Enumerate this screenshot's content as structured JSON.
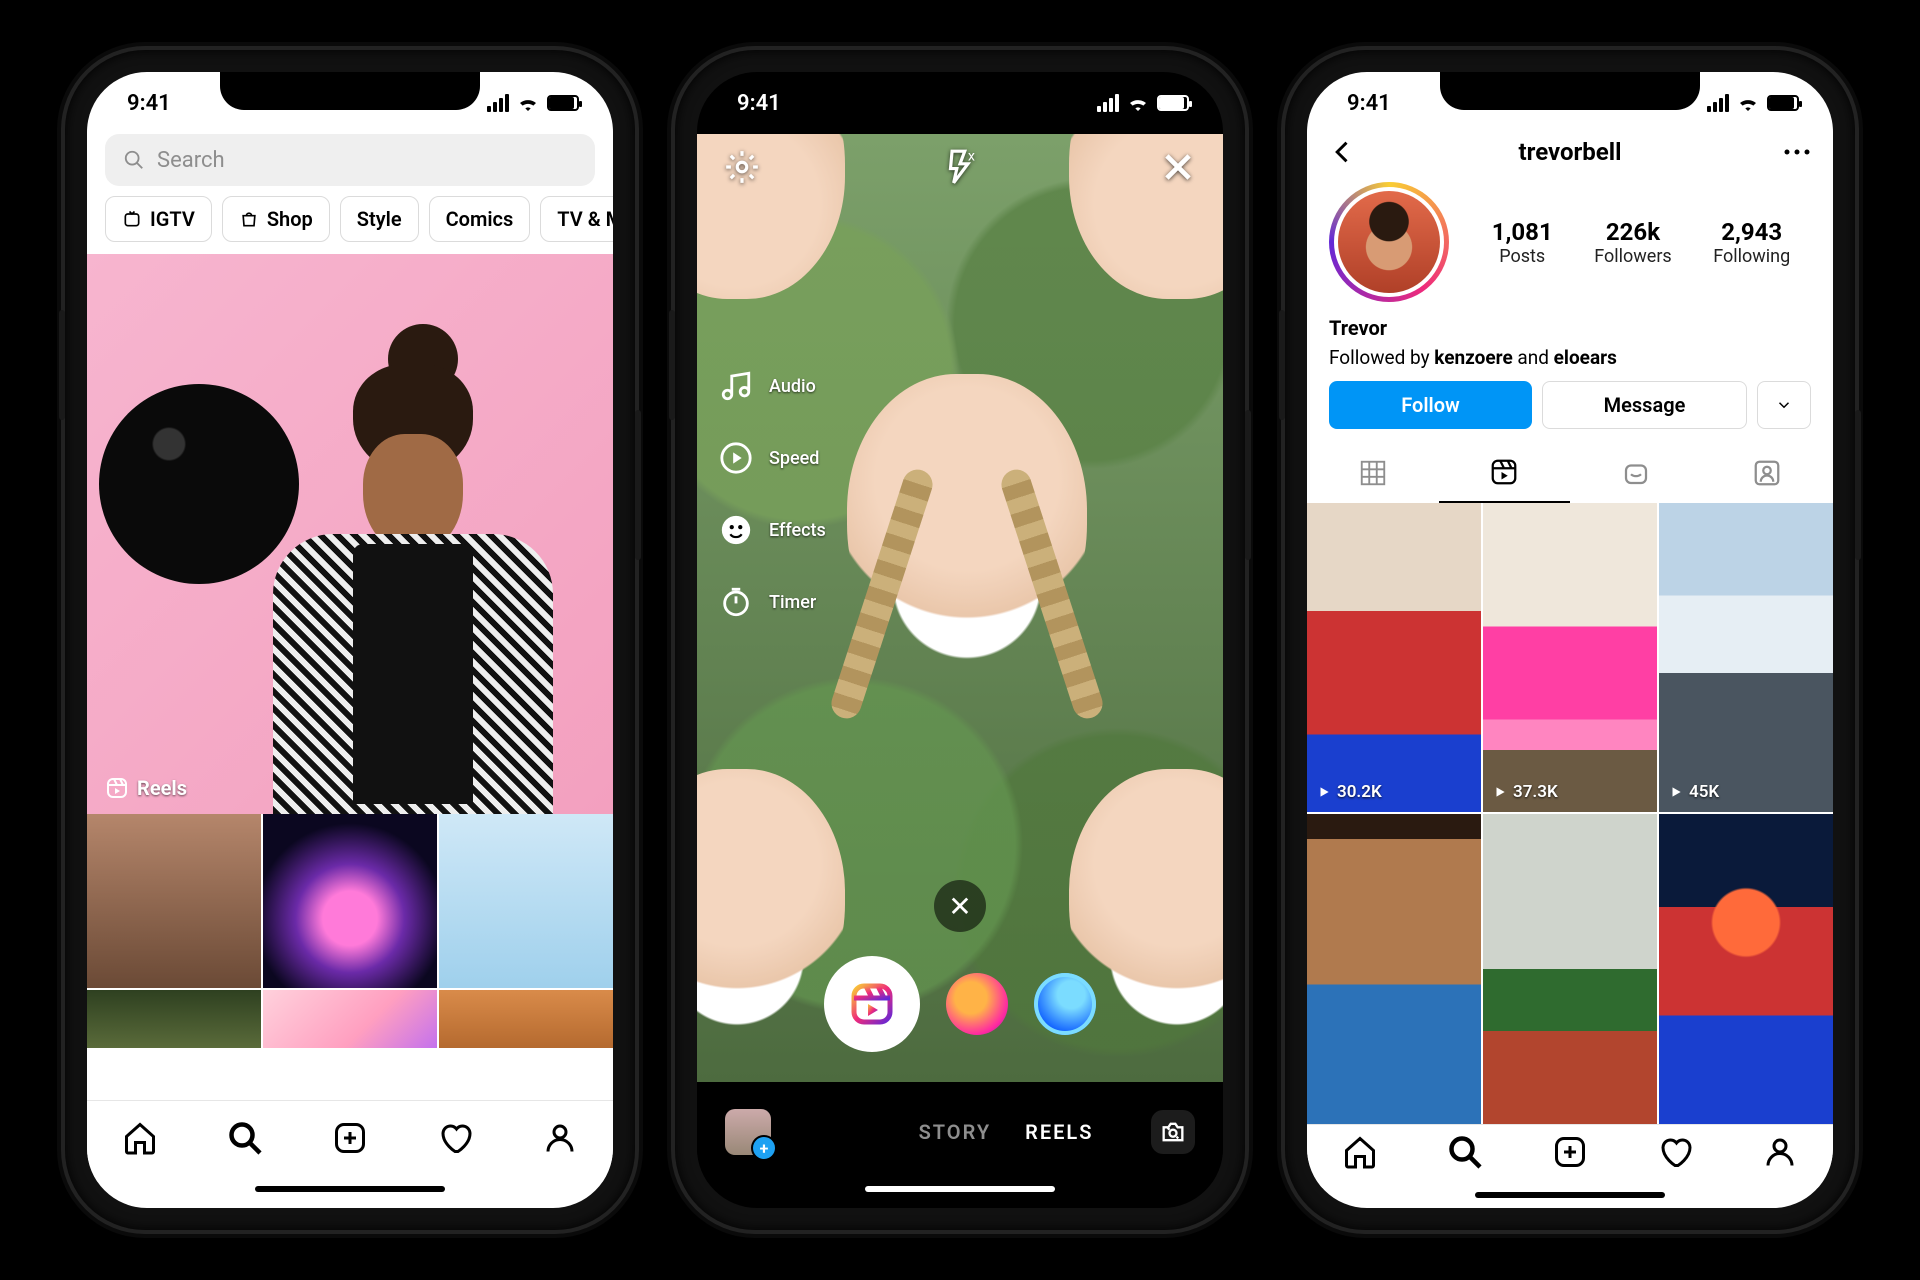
{
  "status": {
    "time": "9:41"
  },
  "explore": {
    "search_placeholder": "Search",
    "chips": [
      "IGTV",
      "Shop",
      "Style",
      "Comics",
      "TV & Movies"
    ],
    "hero_tag": "Reels"
  },
  "camera": {
    "tools": {
      "audio": "Audio",
      "speed": "Speed",
      "effects": "Effects",
      "timer": "Timer"
    },
    "modes": {
      "story": "STORY",
      "reels": "REELS"
    }
  },
  "profile": {
    "username": "trevorbell",
    "stats": {
      "posts_n": "1,081",
      "posts_l": "Posts",
      "followers_n": "226k",
      "followers_l": "Followers",
      "following_n": "2,943",
      "following_l": "Following"
    },
    "display_name": "Trevor",
    "followed_by_prefix": "Followed by ",
    "followed_by_1": "kenzoere",
    "followed_by_sep": " and ",
    "followed_by_2": "eloears",
    "follow_label": "Follow",
    "message_label": "Message",
    "reels": [
      {
        "views": "30.2K"
      },
      {
        "views": "37.3K"
      },
      {
        "views": "45K"
      }
    ]
  }
}
